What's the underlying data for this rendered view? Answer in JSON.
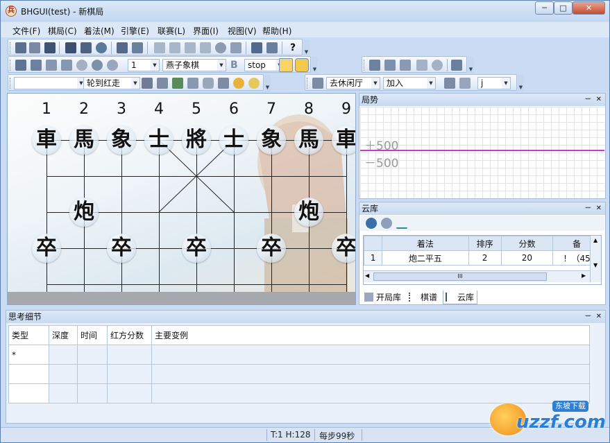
{
  "window": {
    "title": "BHGUI(test) - 新棋局",
    "app_icon": "兵",
    "min_label": "─",
    "max_label": "□",
    "close_label": "✕"
  },
  "menu": [
    "文件(F)",
    "棋局(C)",
    "着法(M)",
    "引擎(E)",
    "联赛(L)",
    "界面(I)",
    "视图(V)",
    "帮助(H)"
  ],
  "toolbar": {
    "help_label": "?",
    "engine_num": "1",
    "engine_name": "燕子象棋",
    "engine_b": "B",
    "stop": "stop",
    "level_select": "",
    "turn_select": "轮到红走",
    "hall": "去休闲厅",
    "join": "加入",
    "j_select": "j"
  },
  "board": {
    "columns": [
      "1",
      "2",
      "3",
      "4",
      "5",
      "6",
      "7",
      "8",
      "9"
    ],
    "pieces": [
      {
        "c": "車",
        "col": 0,
        "row": 0
      },
      {
        "c": "馬",
        "col": 1,
        "row": 0
      },
      {
        "c": "象",
        "col": 2,
        "row": 0
      },
      {
        "c": "士",
        "col": 3,
        "row": 0
      },
      {
        "c": "將",
        "col": 4,
        "row": 0
      },
      {
        "c": "士",
        "col": 5,
        "row": 0
      },
      {
        "c": "象",
        "col": 6,
        "row": 0
      },
      {
        "c": "馬",
        "col": 7,
        "row": 0
      },
      {
        "c": "車",
        "col": 8,
        "row": 0
      },
      {
        "c": "炮",
        "col": 1,
        "row": 2
      },
      {
        "c": "炮",
        "col": 7,
        "row": 2
      },
      {
        "c": "卒",
        "col": 0,
        "row": 3
      },
      {
        "c": "卒",
        "col": 2,
        "row": 3
      },
      {
        "c": "卒",
        "col": 4,
        "row": 3
      },
      {
        "c": "卒",
        "col": 6,
        "row": 3
      },
      {
        "c": "卒",
        "col": 8,
        "row": 3
      }
    ]
  },
  "trend": {
    "title": "局势",
    "pos_label": "＋500",
    "neg_label": "－500"
  },
  "cloud": {
    "title": "云库",
    "columns": [
      "着法",
      "排序",
      "分数",
      "备"
    ],
    "rows": [
      {
        "idx": "1",
        "move": "炮二平五",
        "rank": "2",
        "score": "20",
        "note": "！（45"
      }
    ],
    "scroll_label": "III"
  },
  "right_tabs": [
    "开局库",
    "棋谱",
    "云库"
  ],
  "think": {
    "title": "思考细节",
    "columns": [
      "类型",
      "深度",
      "时间",
      "红方分数",
      "主要变例"
    ],
    "rows": [
      [
        "*",
        "",
        "",
        "",
        ""
      ],
      [
        "",
        "",
        "",
        "",
        ""
      ],
      [
        "",
        "",
        "",
        "",
        ""
      ]
    ]
  },
  "status": {
    "th": "T:1 H:128",
    "per_move": "每步99秒"
  },
  "watermark": {
    "brand": "uzzf.com",
    "sub": "东坡下载"
  },
  "panel_buttons": {
    "pin": "ᅲ",
    "close": "✕"
  }
}
